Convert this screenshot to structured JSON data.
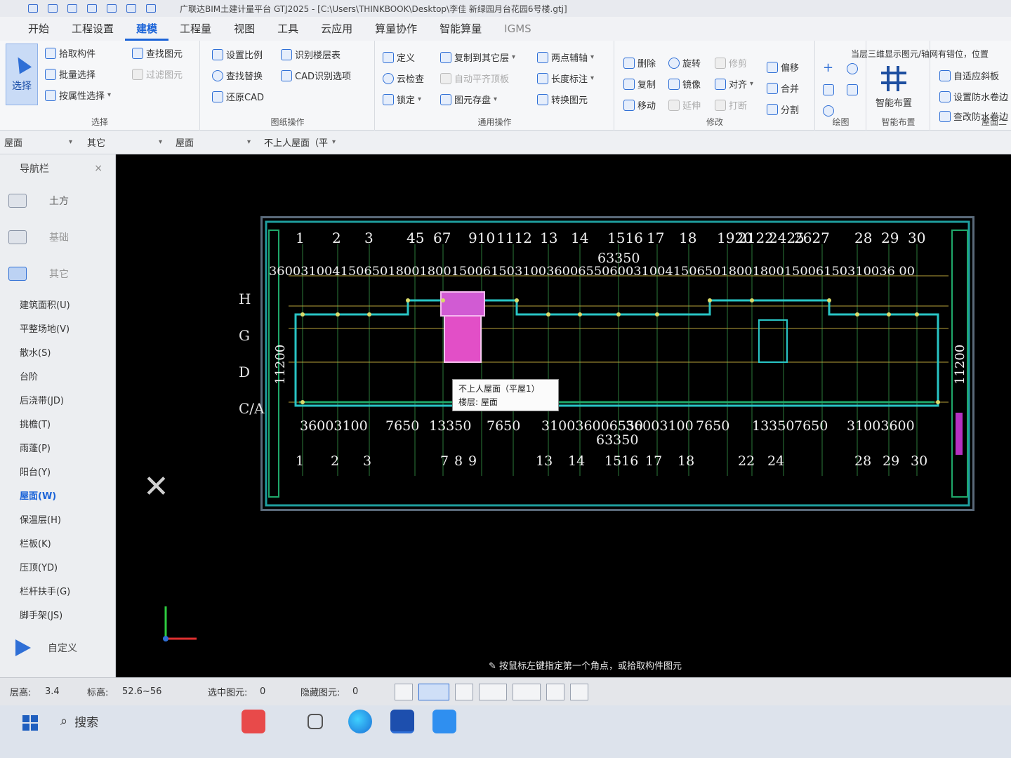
{
  "window": {
    "title": "广联达BIM土建计量平台 GTJ2025 - [C:\\Users\\THINKBOOK\\Desktop\\李佳 新绿园月台花园6号楼.gtj]"
  },
  "menu": {
    "tabs": [
      "开始",
      "工程设置",
      "建模",
      "工程量",
      "视图",
      "工具",
      "云应用",
      "算量协作",
      "智能算量",
      "IGMS"
    ],
    "active_index": 2
  },
  "ribbon": {
    "select_group": {
      "big_label": "选择",
      "items": [
        "拾取构件",
        "批量选择",
        "按属性选择"
      ],
      "items2": [
        "查找图元",
        "过滤图元"
      ],
      "title": "选择"
    },
    "drawing_ops": {
      "items": [
        "设置比例",
        "查找替换",
        "还原CAD"
      ],
      "items2": [
        "识别楼层表",
        "CAD识别选项"
      ],
      "title": "图纸操作"
    },
    "common_ops": {
      "col1": [
        "定义",
        "云检查",
        "锁定"
      ],
      "col2": [
        "复制到其它层",
        "自动平齐顶板",
        "图元存盘"
      ],
      "col3": [
        "两点辅轴",
        "长度标注",
        "转换图元"
      ],
      "title": "通用操作"
    },
    "modify": {
      "col1": [
        "删除",
        "复制",
        "移动"
      ],
      "col2": [
        "旋转",
        "镜像",
        "延伸"
      ],
      "col3": [
        "修剪",
        "对齐",
        "打断"
      ],
      "col4": [
        "偏移",
        "合并",
        "分割"
      ],
      "title": "修改"
    },
    "draw": {
      "title": "绘图"
    },
    "smart_layout": {
      "label": "智能布置",
      "title": "智能布置"
    },
    "right": {
      "hint": "当层三维显示图元/轴网有错位，位置",
      "items": [
        "自适应斜板",
        "设置防水卷边",
        "查改防水卷边"
      ],
      "title": "屋面二"
    }
  },
  "filterbar": {
    "items": [
      "屋面",
      "其它",
      "屋面",
      "不上人屋面（平"
    ]
  },
  "navpanel": {
    "title": "导航栏",
    "categories": [
      "土方",
      "基础",
      "其它"
    ],
    "items": [
      "建筑面积(U)",
      "平整场地(V)",
      "散水(S)",
      "台阶",
      "后浇带(JD)",
      "挑檐(T)",
      "雨蓬(P)",
      "阳台(Y)",
      "屋面(W)",
      "保温层(H)",
      "栏板(K)",
      "压顶(YD)",
      "栏杆扶手(G)",
      "脚手架(JS)"
    ],
    "active_item": "屋面(W)",
    "custom_label": "自定义"
  },
  "drawing": {
    "top_axis_numbers": [
      "1",
      "2",
      "3",
      "45",
      "67",
      "910",
      "1112",
      "13",
      "14",
      "1516",
      "17",
      "18",
      "1920",
      "2122",
      "2425",
      "2627",
      "28",
      "29",
      "30"
    ],
    "top_dims": "3600310041506501800180015006150310036006550600310041506501800180015006150310036 00",
    "total_top": "63350",
    "bottom_dims": [
      "36003100",
      "7650",
      "13350",
      "7650",
      "310036006550",
      "36003100",
      "7650",
      "13350",
      "7650",
      "31003600"
    ],
    "total_bottom": "63350",
    "bottom_axis_numbers": [
      "1",
      "2",
      "3",
      "7",
      "8",
      "9",
      "13",
      "14",
      "1516",
      "17",
      "18",
      "22",
      "24",
      "28",
      "29",
      "30"
    ],
    "left_rows": [
      "H",
      "G",
      "D",
      "C/A"
    ],
    "left_dims": "11200",
    "right_dims": "11200"
  },
  "tooltip": {
    "line1": "不上人屋面（平屋1）",
    "line2": "楼层: 屋面"
  },
  "prompt": "按鼠标左键指定第一个角点，或拾取构件图元",
  "status": {
    "floor_height_label": "层高:",
    "floor_height": "3.4",
    "elevation_label": "标高:",
    "elevation": "52.6~56",
    "selected_label": "选中图元:",
    "selected": "0",
    "hidden_label": "隐藏图元:",
    "hidden": "0"
  },
  "taskbar": {
    "search": "搜索"
  }
}
